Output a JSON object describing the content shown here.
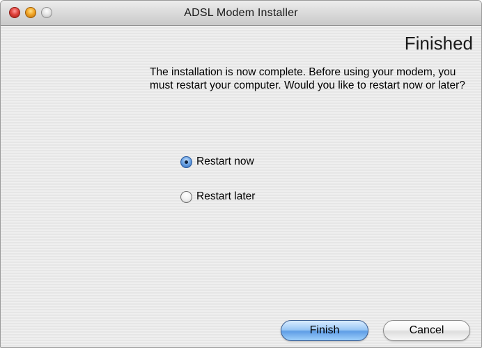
{
  "window": {
    "title": "ADSL Modem Installer"
  },
  "page": {
    "heading": "Finished",
    "message": "The installation is now complete.  Before using your modem, you must restart your computer.  Would you like to restart now or later?"
  },
  "options": {
    "restart_now_label": "Restart now",
    "restart_later_label": "Restart later",
    "selected": "Restart now"
  },
  "buttons": {
    "finish_label": "Finish",
    "cancel_label": "Cancel"
  },
  "colors": {
    "close": "#e0443e",
    "minimize": "#f2a627",
    "zoom": "#e2e2e2",
    "default_button": "#5f9ee6"
  }
}
